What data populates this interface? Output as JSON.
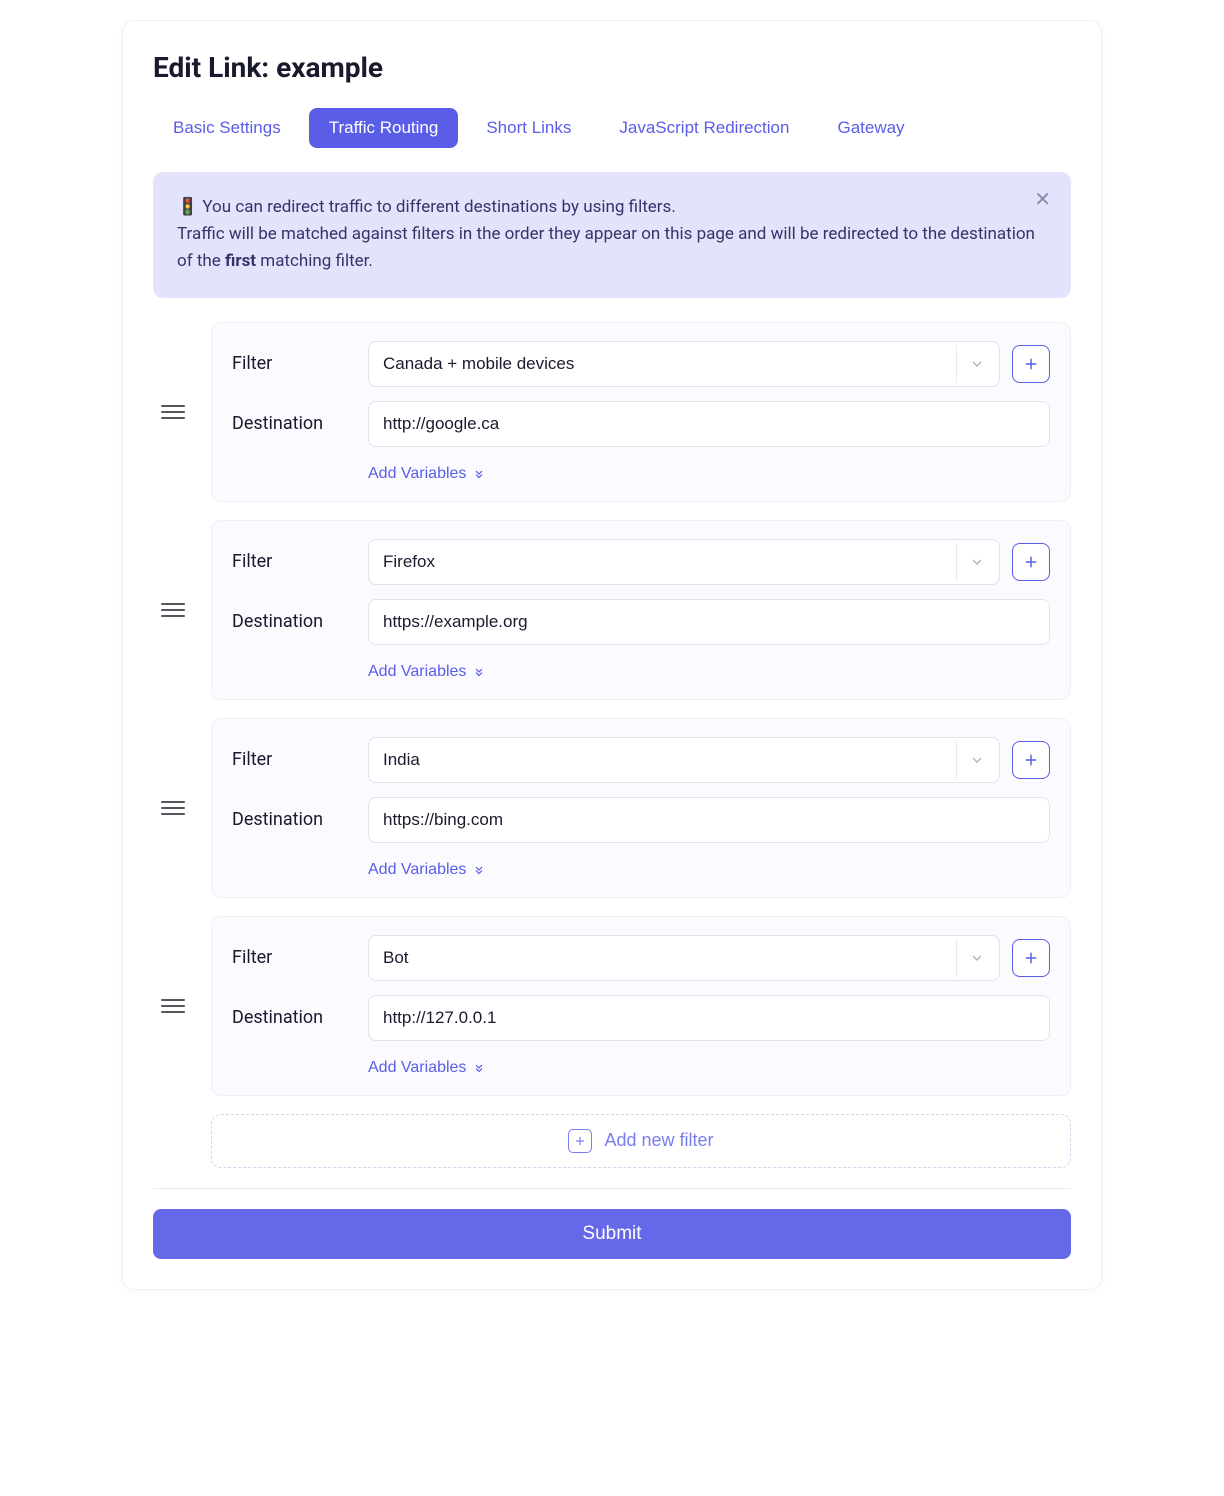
{
  "title": "Edit Link: example",
  "tabs": [
    {
      "label": "Basic Settings",
      "active": false
    },
    {
      "label": "Traffic Routing",
      "active": true
    },
    {
      "label": "Short Links",
      "active": false
    },
    {
      "label": "JavaScript Redirection",
      "active": false
    },
    {
      "label": "Gateway",
      "active": false
    }
  ],
  "banner": {
    "line1_prefix": "🚦 ",
    "line1": "You can redirect traffic to different destinations by using filters.",
    "line2_a": "Traffic will be matched against filters in the order they appear on this page and will be redirected to the destination of the ",
    "line2_strong": "first",
    "line2_b": " matching filter."
  },
  "labels": {
    "filter": "Filter",
    "destination": "Destination",
    "add_variables": "Add Variables",
    "add_new_filter": "Add new filter",
    "submit": "Submit"
  },
  "filters": [
    {
      "filter_value": "Canada + mobile devices",
      "destination": "http://google.ca"
    },
    {
      "filter_value": "Firefox",
      "destination": "https://example.org"
    },
    {
      "filter_value": "India",
      "destination": "https://bing.com"
    },
    {
      "filter_value": "Bot",
      "destination": "http://127.0.0.1"
    }
  ]
}
